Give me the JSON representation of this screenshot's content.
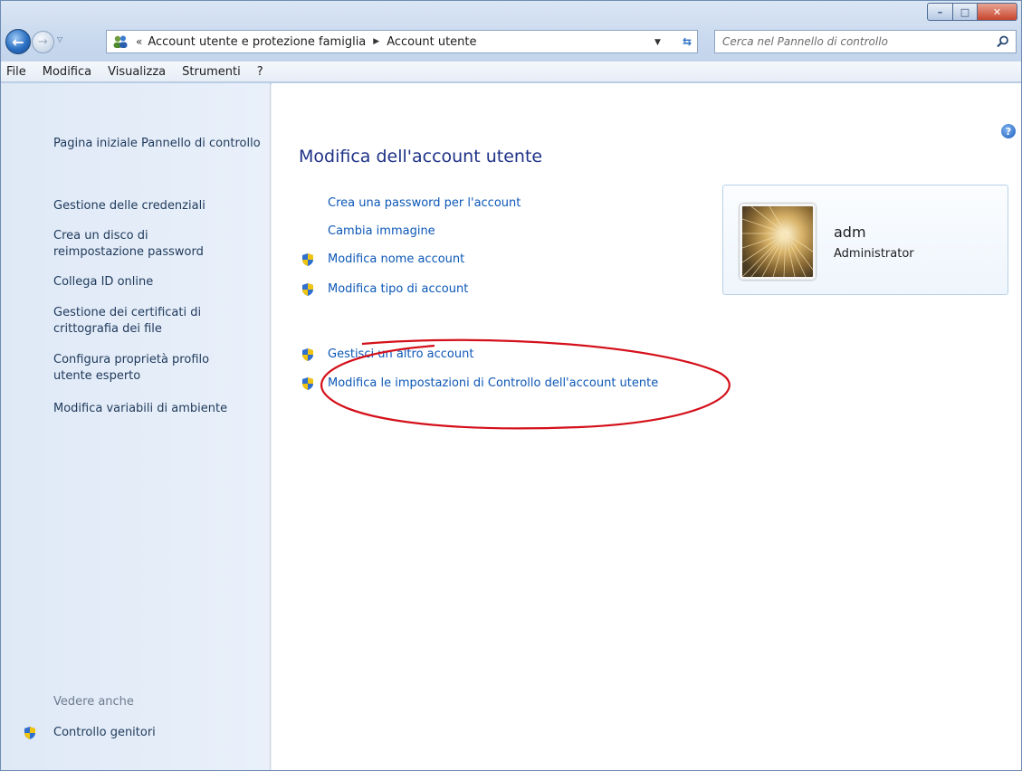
{
  "window": {
    "controls": {
      "minimize": "–",
      "maximize": "□",
      "close": "✕"
    }
  },
  "navigation": {
    "back_icon": "back-arrow-icon",
    "forward_icon": "forward-arrow-icon",
    "breadcrumb_prefix": "«",
    "breadcrumbs": [
      "Account utente e protezione famiglia",
      "Account utente"
    ],
    "search_placeholder": "Cerca nel Pannello di controllo"
  },
  "menu": {
    "items": [
      "File",
      "Modifica",
      "Visualizza",
      "Strumenti",
      "?"
    ]
  },
  "left_pane": {
    "links": [
      "Pagina iniziale Pannello di controllo",
      "Gestione delle credenziali",
      "Crea un disco di reimpostazione password",
      "Collega ID online",
      "Gestione dei certificati di crittografia dei file",
      "Configura proprietà profilo utente esperto",
      "Modifica variabili di ambiente"
    ],
    "see_also": "Vedere anche",
    "parental_controls": "Controllo genitori"
  },
  "main": {
    "title": "Modifica dell'account utente",
    "tasks": [
      {
        "label": "Crea una password per l'account",
        "shield": false
      },
      {
        "label": "Cambia immagine",
        "shield": false
      },
      {
        "label": "Modifica nome account",
        "shield": true
      },
      {
        "label": "Modifica tipo di account",
        "shield": true
      }
    ],
    "other_tasks": [
      {
        "label": "Gestisci un altro account",
        "shield": true
      },
      {
        "label": "Modifica le impostazioni di Controllo dell'account utente",
        "shield": true
      }
    ],
    "help_icon": "?"
  },
  "account": {
    "name": "adm",
    "type": "Administrator"
  },
  "colors": {
    "link": "#0c57b7",
    "title": "#1e3287",
    "annotation": "#d4101a"
  }
}
